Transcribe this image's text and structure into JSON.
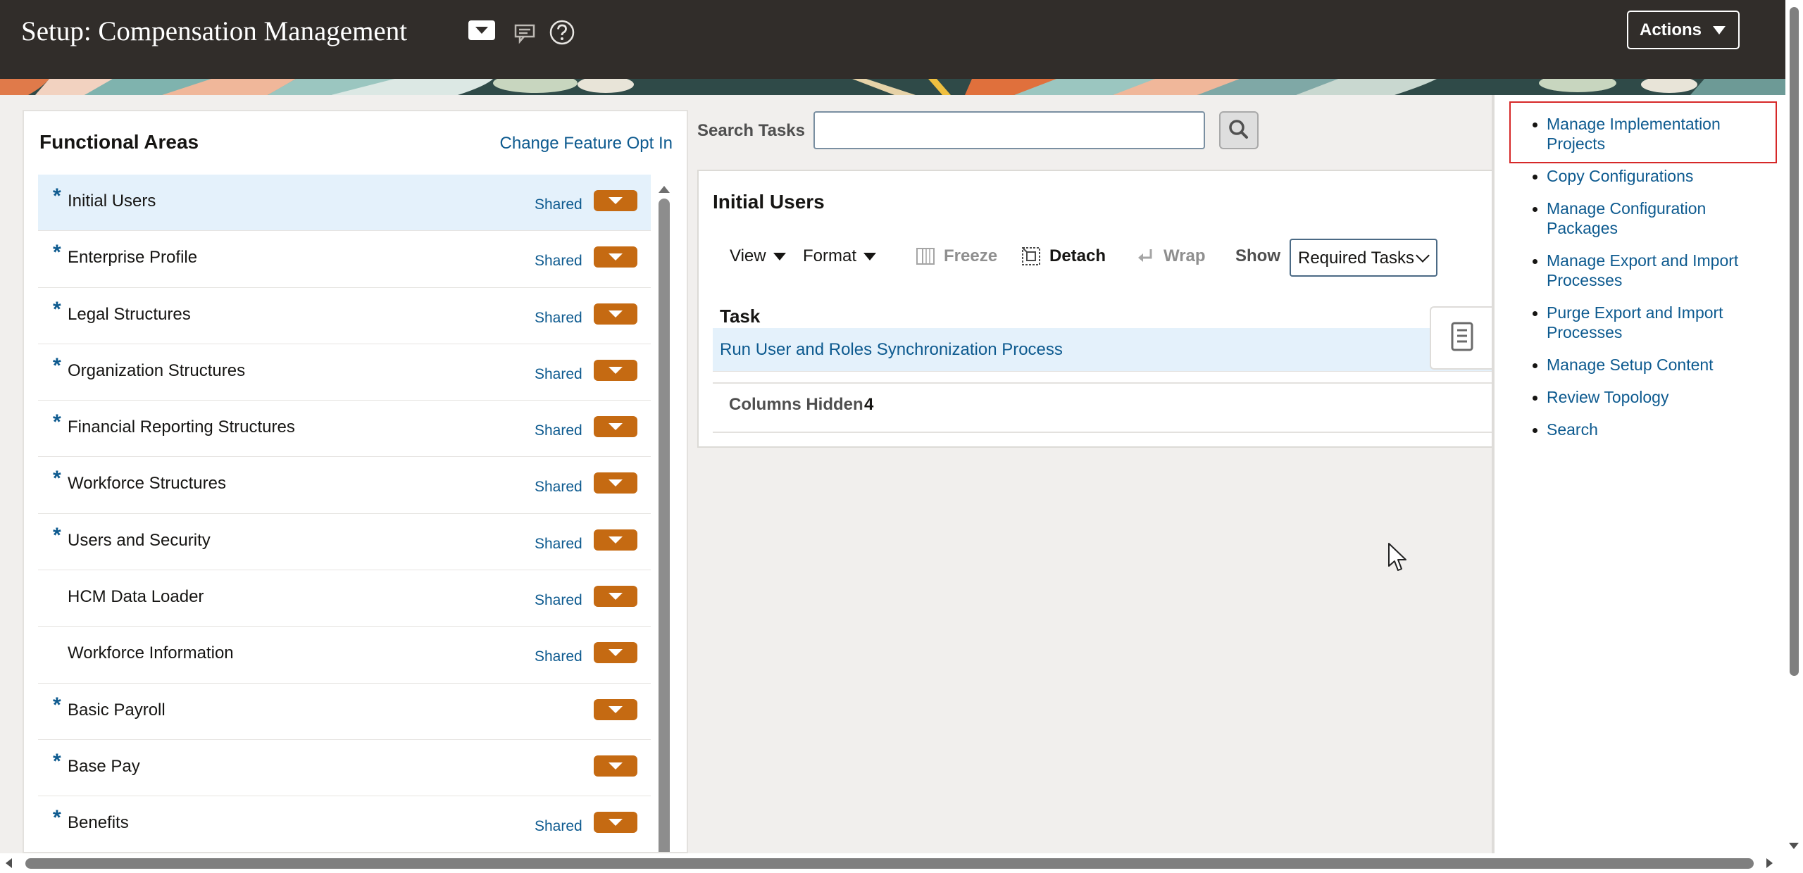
{
  "header": {
    "title": "Setup: Compensation Management",
    "actions_label": "Actions",
    "icons": [
      "chevron-down-icon",
      "announcement-icon",
      "help-icon"
    ]
  },
  "functional_areas": {
    "title": "Functional Areas",
    "feature_link": "Change Feature Opt In",
    "items": [
      {
        "label": "Initial Users",
        "required": "*",
        "shared": "Shared",
        "selected": true
      },
      {
        "label": "Enterprise Profile",
        "required": "*",
        "shared": "Shared"
      },
      {
        "label": "Legal Structures",
        "required": "*",
        "shared": "Shared"
      },
      {
        "label": "Organization Structures",
        "required": "*",
        "shared": "Shared"
      },
      {
        "label": "Financial Reporting Structures",
        "required": "*",
        "shared": "Shared"
      },
      {
        "label": "Workforce Structures",
        "required": "*",
        "shared": "Shared"
      },
      {
        "label": "Users and Security",
        "required": "*",
        "shared": "Shared"
      },
      {
        "label": "HCM Data Loader",
        "required": "",
        "shared": "Shared"
      },
      {
        "label": "Workforce Information",
        "required": "",
        "shared": "Shared"
      },
      {
        "label": "Basic Payroll",
        "required": "*",
        "shared": ""
      },
      {
        "label": "Base Pay",
        "required": "*",
        "shared": ""
      },
      {
        "label": "Benefits",
        "required": "*",
        "shared": "Shared"
      }
    ]
  },
  "search": {
    "label": "Search Tasks",
    "value": "",
    "placeholder": ""
  },
  "task_panel": {
    "title": "Initial Users",
    "toolbar": {
      "view": "View",
      "format": "Format",
      "freeze": "Freeze",
      "detach": "Detach",
      "wrap": "Wrap",
      "show_label": "Show",
      "show_value": "Required Tasks"
    },
    "column_header": "Task",
    "rows": [
      "Run User and Roles Synchronization Process"
    ],
    "columns_hidden_label": "Columns Hidden",
    "columns_hidden_count": "4"
  },
  "right_panel": {
    "links": [
      {
        "label": "Manage Implementation Projects",
        "highlighted": true
      },
      {
        "label": "Copy Configurations"
      },
      {
        "label": "Manage Configuration Packages"
      },
      {
        "label": "Manage Export and Import Processes"
      },
      {
        "label": "Purge Export and Import Processes"
      },
      {
        "label": "Manage Setup Content"
      },
      {
        "label": "Review Topology"
      },
      {
        "label": "Search"
      }
    ]
  },
  "colors": {
    "header_bg": "#312d2a",
    "link": "#0d5a8f",
    "accent_button": "#c56a12",
    "selected_row": "#e4f1fb",
    "highlight_border": "#d62828"
  }
}
